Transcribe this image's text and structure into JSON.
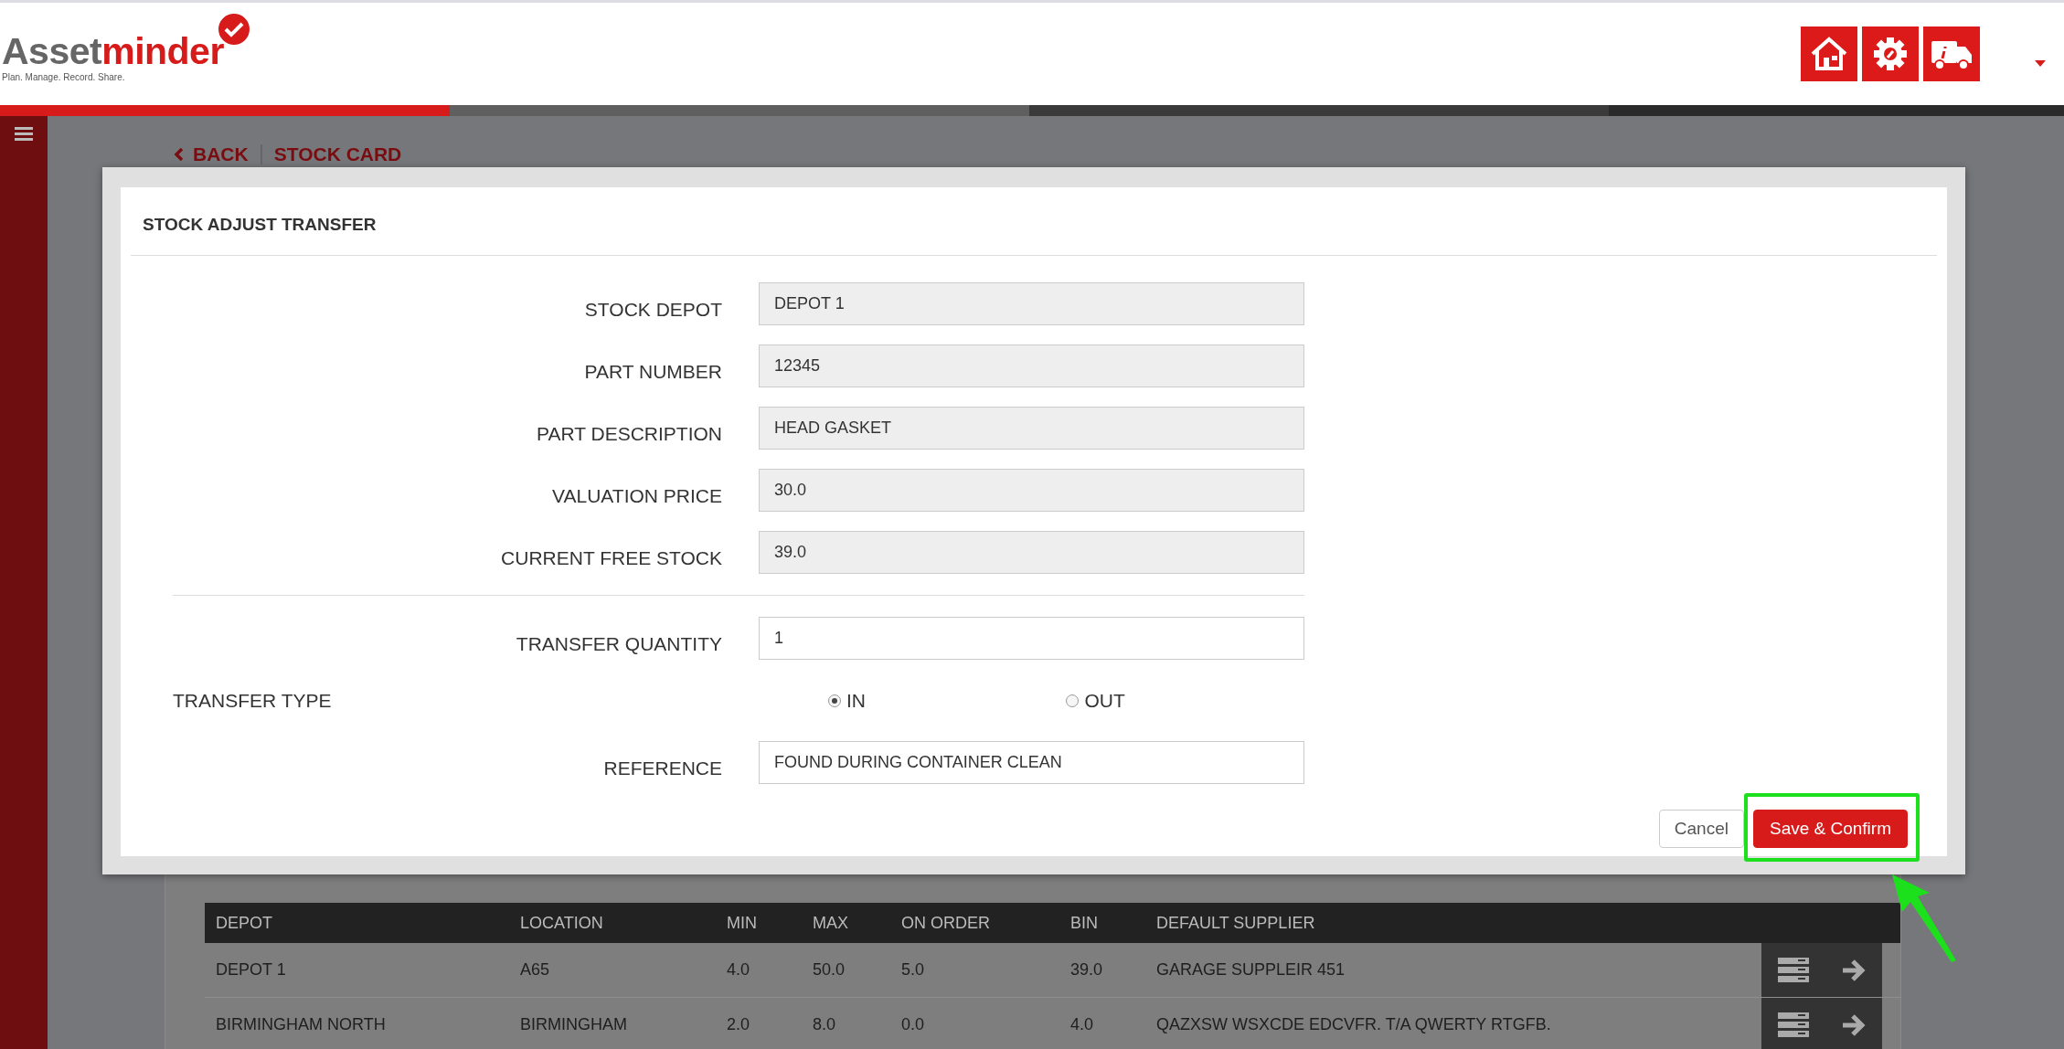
{
  "header": {
    "logo": {
      "word_1": "Asset",
      "word_2": "minder",
      "tagline": "Plan. Manage. Record. Share."
    }
  },
  "breadcrumb": {
    "back": "BACK",
    "current": "STOCK CARD"
  },
  "modal": {
    "title": "STOCK ADJUST TRANSFER",
    "fields": [
      {
        "label": "STOCK DEPOT",
        "value": "DEPOT 1",
        "disabled": true
      },
      {
        "label": "PART NUMBER",
        "value": "12345",
        "disabled": true
      },
      {
        "label": "PART DESCRIPTION",
        "value": "HEAD GASKET",
        "disabled": true
      },
      {
        "label": "VALUATION PRICE",
        "value": "30.0",
        "disabled": true
      },
      {
        "label": "CURRENT FREE STOCK",
        "value": "39.0",
        "disabled": true
      }
    ],
    "quantity": {
      "label": "TRANSFER QUANTITY",
      "value": "1",
      "disabled": false
    },
    "transfer_type": {
      "label": "TRANSFER TYPE",
      "options": [
        {
          "label": "IN",
          "selected": true
        },
        {
          "label": "OUT",
          "selected": false
        }
      ]
    },
    "reference": {
      "label": "REFERENCE",
      "value": "FOUND DURING CONTAINER CLEAN",
      "disabled": false
    },
    "buttons": [
      {
        "label": "Cancel",
        "kind": "secondary",
        "highlighted": false
      },
      {
        "label": "Save & Confirm",
        "kind": "primary",
        "highlighted": true
      }
    ]
  },
  "table": {
    "columns": [
      "DEPOT",
      "LOCATION",
      "MIN",
      "MAX",
      "ON ORDER",
      "BIN",
      "DEFAULT SUPPLIER"
    ],
    "rows": [
      {
        "cells": [
          "DEPOT 1",
          "A65",
          "4.0",
          "50.0",
          "5.0",
          "39.0",
          "GARAGE SUPPLEIR 451"
        ]
      },
      {
        "cells": [
          "BIRMINGHAM NORTH",
          "BIRMINGHAM",
          "2.0",
          "8.0",
          "0.0",
          "4.0",
          "QAZXSW WSXCDE EDCVFR. T/A QWERTY RTGFB."
        ]
      }
    ]
  }
}
